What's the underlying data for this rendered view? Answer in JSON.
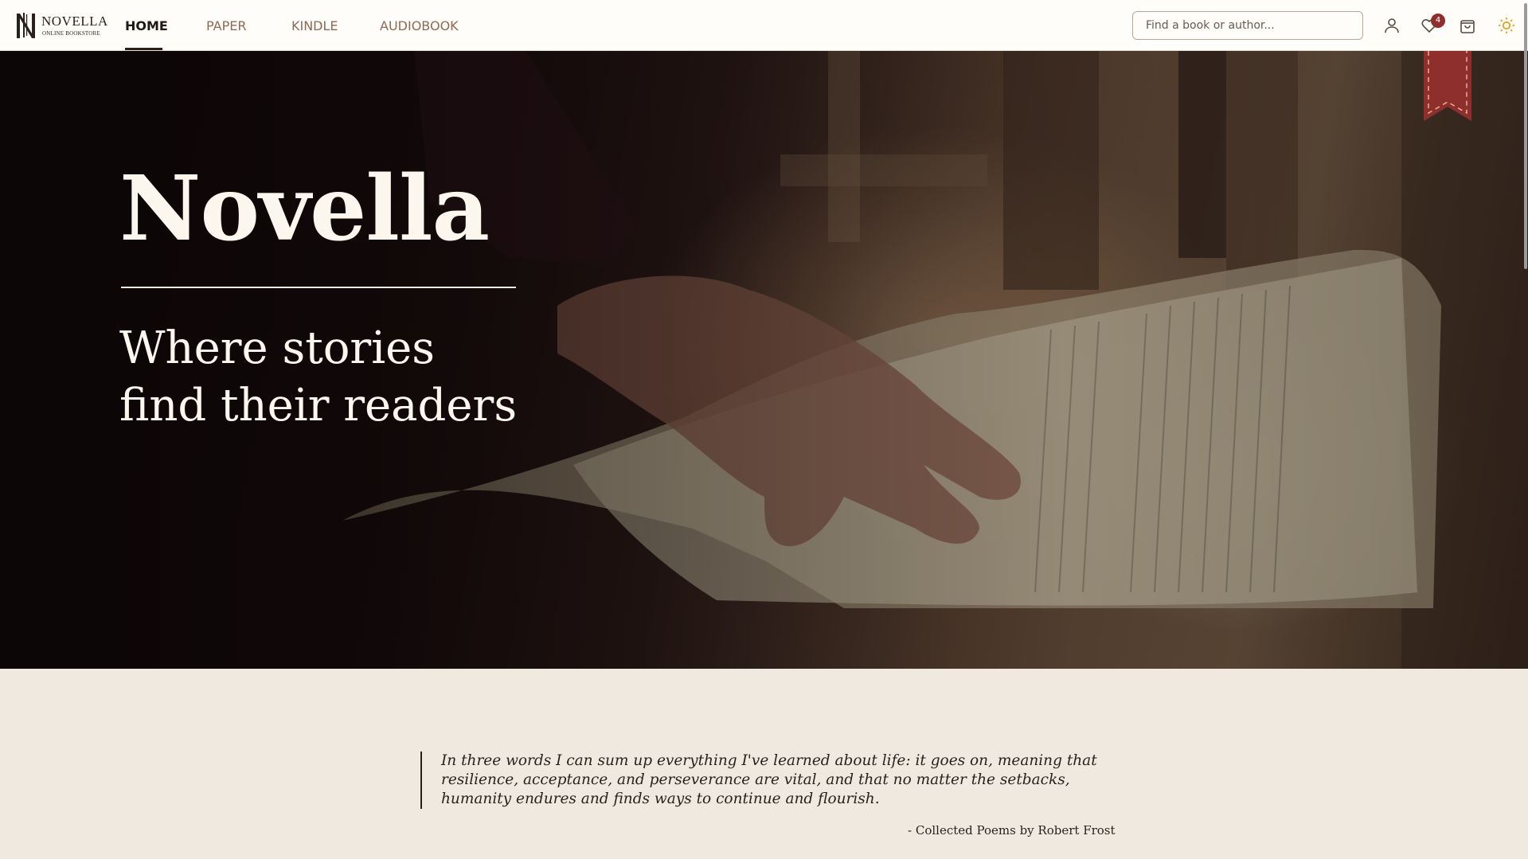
{
  "brand": {
    "name": "NOVELLA",
    "tagline": "ONLINE BOOKSTORE"
  },
  "nav": {
    "links": [
      {
        "label": "HOME",
        "active": true
      },
      {
        "label": "PAPER",
        "active": false
      },
      {
        "label": "KINDLE",
        "active": false
      },
      {
        "label": "AUDIOBOOK",
        "active": false
      }
    ]
  },
  "search": {
    "placeholder": "Find a book or author...",
    "value": ""
  },
  "icons": {
    "account": "user-icon",
    "wishlist": "heart-icon",
    "cart": "shopping-bag-icon",
    "theme": "sun-icon"
  },
  "wishlist": {
    "count": "4"
  },
  "hero": {
    "title": "Novella",
    "tagline_line1": "Where stories",
    "tagline_line2": "find their readers"
  },
  "quote": {
    "line1": "In three words I can sum up everything I've learned about life: it goes on, meaning that",
    "line2": "resilience, acceptance, and perseverance are vital, and that no matter the setbacks,",
    "line3": "humanity endures and finds ways to continue and flourish.",
    "attribution": "- Collected Poems by Robert Frost"
  },
  "colors": {
    "accent": "#8e2f2e",
    "page_background": "#efe9df",
    "nav_background": "#fffdf9",
    "nav_inactive": "#8c6a55",
    "text_dark": "#2b1f1b",
    "theme_icon": "#e0a21b"
  }
}
